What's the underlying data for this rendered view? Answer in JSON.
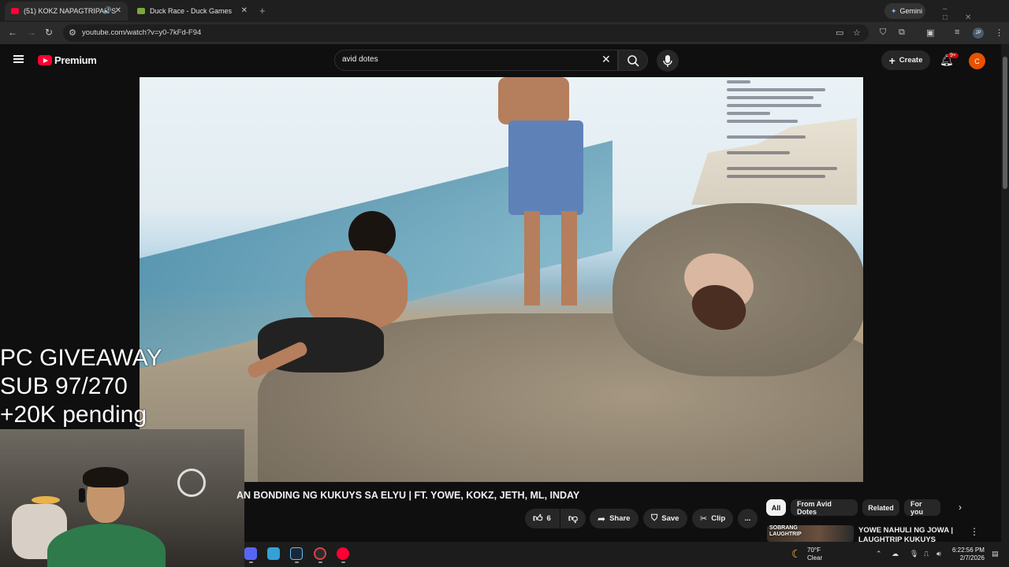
{
  "browser": {
    "tabs": [
      {
        "title": "(51) KOKZ NAPAGTRIPAN S",
        "active": true
      },
      {
        "title": "Duck Race - Duck Games",
        "active": false
      }
    ],
    "new_tab": "+",
    "gemini_label": "Gemini",
    "url": "youtube.com/watch?v=y0-7kFd-F94"
  },
  "youtube": {
    "brand": "Premium",
    "search_query": "avid dotes",
    "create_label": "Create",
    "notification_badge": "9+",
    "avatar_letter": "C",
    "video": {
      "overlay_text": [
        "PC GIVEAWAY",
        "SUB 97/270",
        "+20K pending"
      ],
      "title": "AN BONDING NG KUKUYS SA ELYU | FT. YOWE, KOKZ, JETH, ML, INDAY"
    },
    "actions": {
      "like_count": "6",
      "share": "Share",
      "save": "Save",
      "clip": "Clip",
      "more": "..."
    },
    "chips": [
      "All",
      "From Avid Dotes",
      "Related",
      "For you"
    ],
    "recommendation": {
      "thumb_label_1": "SOBRANG",
      "thumb_label_2": "LAUGHTRIP",
      "title": "YOWE NAHULI NG JOWA | LAUGHTRIP KUKUYS"
    }
  },
  "taskbar": {
    "weather_temp": "70°F",
    "weather_desc": "Clear",
    "time": "6:22:56 PM",
    "date": "2/7/2026"
  },
  "colors": {
    "youtube_red": "#ff0033",
    "background": "#0f0f0f",
    "avatar": "#e65100"
  }
}
